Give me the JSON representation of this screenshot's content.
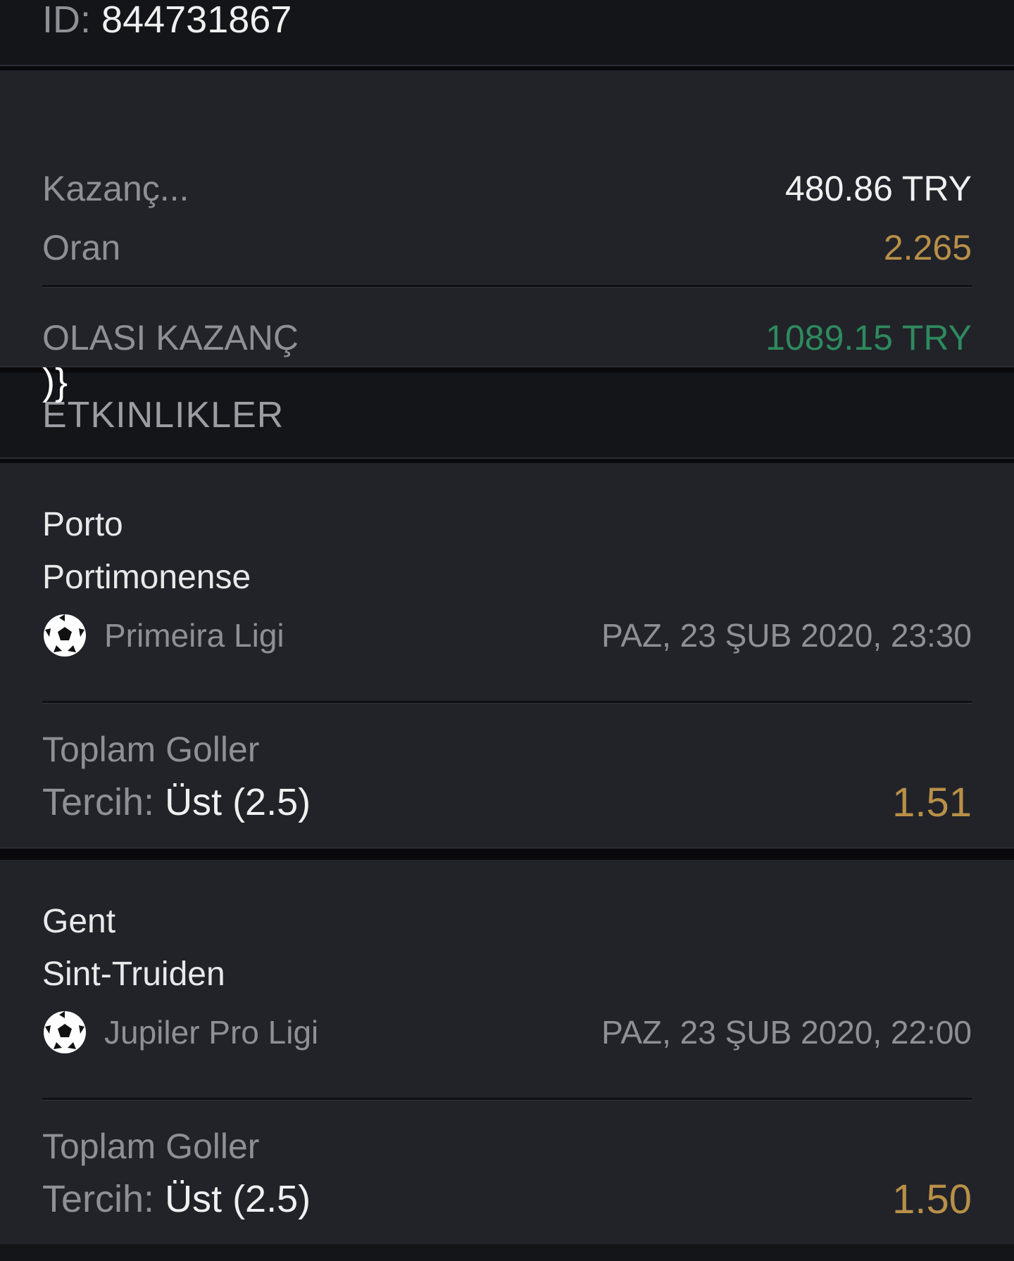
{
  "header": {
    "id_label": "ID:",
    "id_value": "844731867"
  },
  "summary": {
    "stake_label": "Kazanç...",
    "stake_value": "480.86 TRY",
    "odds_label": "Oran",
    "odds_value": "2.265",
    "potential_label": "OLASI KAZANÇ",
    "potential_value": "1089.15 TRY",
    "stray_text": ")}"
  },
  "events_section": {
    "title": "ETKINLIKLER"
  },
  "events": [
    {
      "home": "Porto",
      "away": "Portimonense",
      "sport_icon": "soccer-ball-icon",
      "league": "Primeira Ligi",
      "datetime": "PAZ, 23 ŞUB 2020, 23:30",
      "market": "Toplam Goller",
      "pick_label": "Tercih:",
      "pick_value": "Üst (2.5)",
      "odd": "1.51"
    },
    {
      "home": "Gent",
      "away": "Sint-Truiden",
      "sport_icon": "soccer-ball-icon",
      "league": "Jupiler Pro Ligi",
      "datetime": "PAZ, 23 ŞUB 2020, 22:00",
      "market": "Toplam Goller",
      "pick_label": "Tercih:",
      "pick_value": "Üst (2.5)",
      "odd": "1.50"
    }
  ],
  "colors": {
    "background": "#141519",
    "panel": "#212329",
    "muted_text": "#8e9096",
    "odds_gold": "#b89047",
    "potential_green": "#2e8a5e"
  }
}
